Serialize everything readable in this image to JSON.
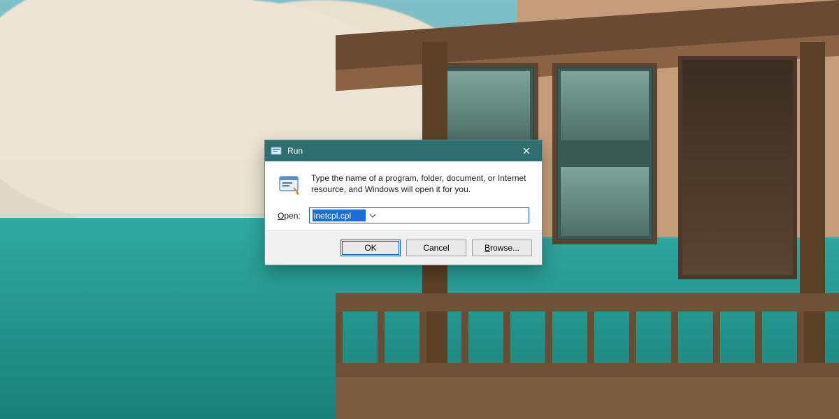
{
  "dialog": {
    "title": "Run",
    "description": "Type the name of a program, folder, document, or Internet resource, and Windows will open it for you.",
    "open_label_accesskey": "O",
    "open_label_rest": "pen:",
    "input_value": "inetcpl.cpl",
    "buttons": {
      "ok": "OK",
      "cancel": "Cancel",
      "browse_accesskey": "B",
      "browse_rest": "rowse..."
    }
  },
  "icons": {
    "app": "run-app-icon",
    "run": "run-program-icon",
    "close": "close-icon",
    "chevron": "chevron-down-icon"
  },
  "colors": {
    "titlebar": "#2f6f6f",
    "selection": "#1a6fd6",
    "focus_border": "#0b61c4"
  }
}
